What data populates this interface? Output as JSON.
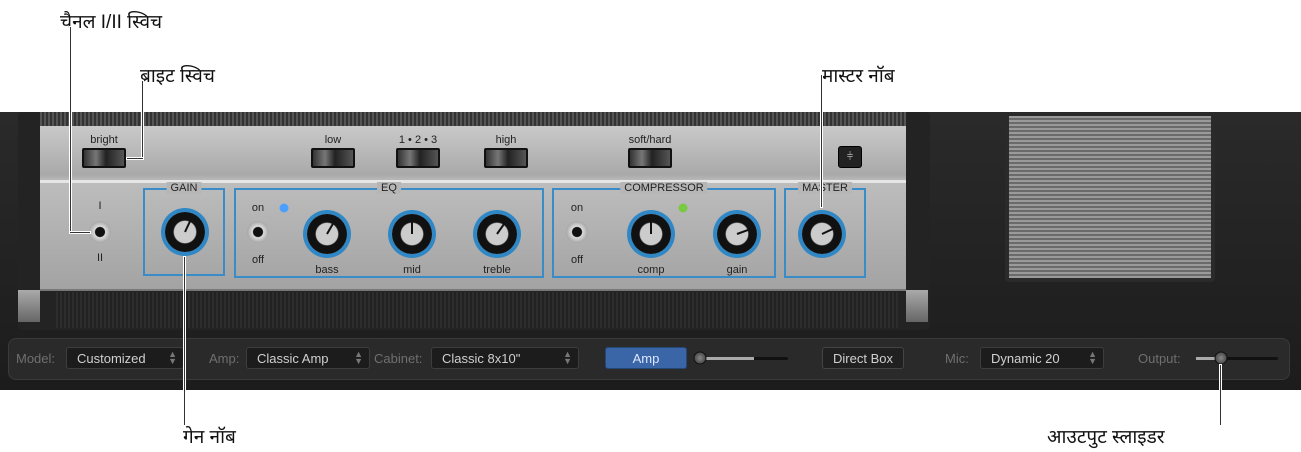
{
  "callouts": {
    "channel_switch": "चैनल I/II स्विच",
    "bright_switch": "ब्राइट स्विच",
    "master_knob": "मास्टर नॉब",
    "gain_knob": "गेन नॉब",
    "output_slider": "आउटपुट स्लाइडर"
  },
  "amp": {
    "top_switches": {
      "bright": "bright",
      "low": "low",
      "mid_freq": "1 • 2 • 3",
      "high": "high",
      "soft_hard": "soft/hard"
    },
    "channel": {
      "top": "I",
      "bottom": "II"
    },
    "groups": {
      "gain": "GAIN",
      "eq": "EQ",
      "compressor": "COMPRESSOR",
      "master": "MASTER"
    },
    "eq": {
      "on": "on",
      "off": "off",
      "bass": "bass",
      "mid": "mid",
      "treble": "treble"
    },
    "compressor": {
      "on": "on",
      "off": "off",
      "comp": "comp",
      "gain": "gain"
    },
    "led_colors": {
      "eq": "#4aa0ff",
      "compressor": "#7ac943"
    }
  },
  "toolbar": {
    "model_label": "Model:",
    "model_value": "Customized",
    "amp_label": "Amp:",
    "amp_value": "Classic Amp",
    "cabinet_label": "Cabinet:",
    "cabinet_value": "Classic 8x10\"",
    "amp_button": "Amp",
    "direct_box_button": "Direct Box",
    "mic_label": "Mic:",
    "mic_value": "Dynamic 20",
    "output_label": "Output:",
    "blend_value": 0.0,
    "output_value": 0.25
  }
}
